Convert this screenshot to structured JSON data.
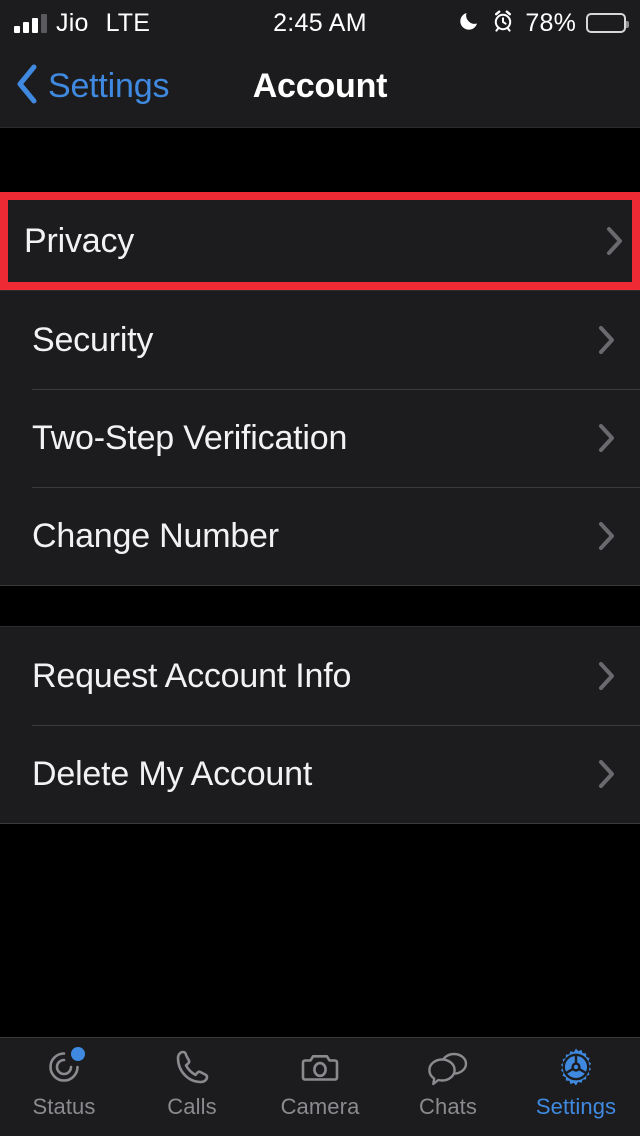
{
  "status_bar": {
    "carrier": "Jio",
    "network": "LTE",
    "time": "2:45 AM",
    "battery_percent": "78%",
    "icons": [
      "signal-bars-icon",
      "moon-icon",
      "alarm-icon",
      "battery-icon"
    ]
  },
  "nav_bar": {
    "back_label": "Settings",
    "title": "Account",
    "back_icon": "chevron-left-icon",
    "accent_color": "#3f8ae0"
  },
  "highlight": {
    "color": "#ee2b35",
    "target": "Privacy"
  },
  "sections": [
    {
      "rows": [
        {
          "label": "Privacy",
          "highlighted": true
        }
      ]
    },
    {
      "rows": [
        {
          "label": "Security",
          "highlighted": false
        },
        {
          "label": "Two-Step Verification",
          "highlighted": false
        },
        {
          "label": "Change Number",
          "highlighted": false
        }
      ]
    },
    {
      "rows": [
        {
          "label": "Request Account Info",
          "highlighted": false
        },
        {
          "label": "Delete My Account",
          "highlighted": false
        }
      ]
    }
  ],
  "tab_bar": {
    "active_color": "#3f8ae0",
    "inactive_color": "#8b8b8f",
    "tabs": [
      {
        "label": "Status",
        "icon": "status-rings-icon",
        "active": false,
        "badge": true
      },
      {
        "label": "Calls",
        "icon": "phone-icon",
        "active": false,
        "badge": false
      },
      {
        "label": "Camera",
        "icon": "camera-icon",
        "active": false,
        "badge": false
      },
      {
        "label": "Chats",
        "icon": "chat-bubbles-icon",
        "active": false,
        "badge": false
      },
      {
        "label": "Settings",
        "icon": "gear-icon",
        "active": true,
        "badge": false
      }
    ]
  }
}
